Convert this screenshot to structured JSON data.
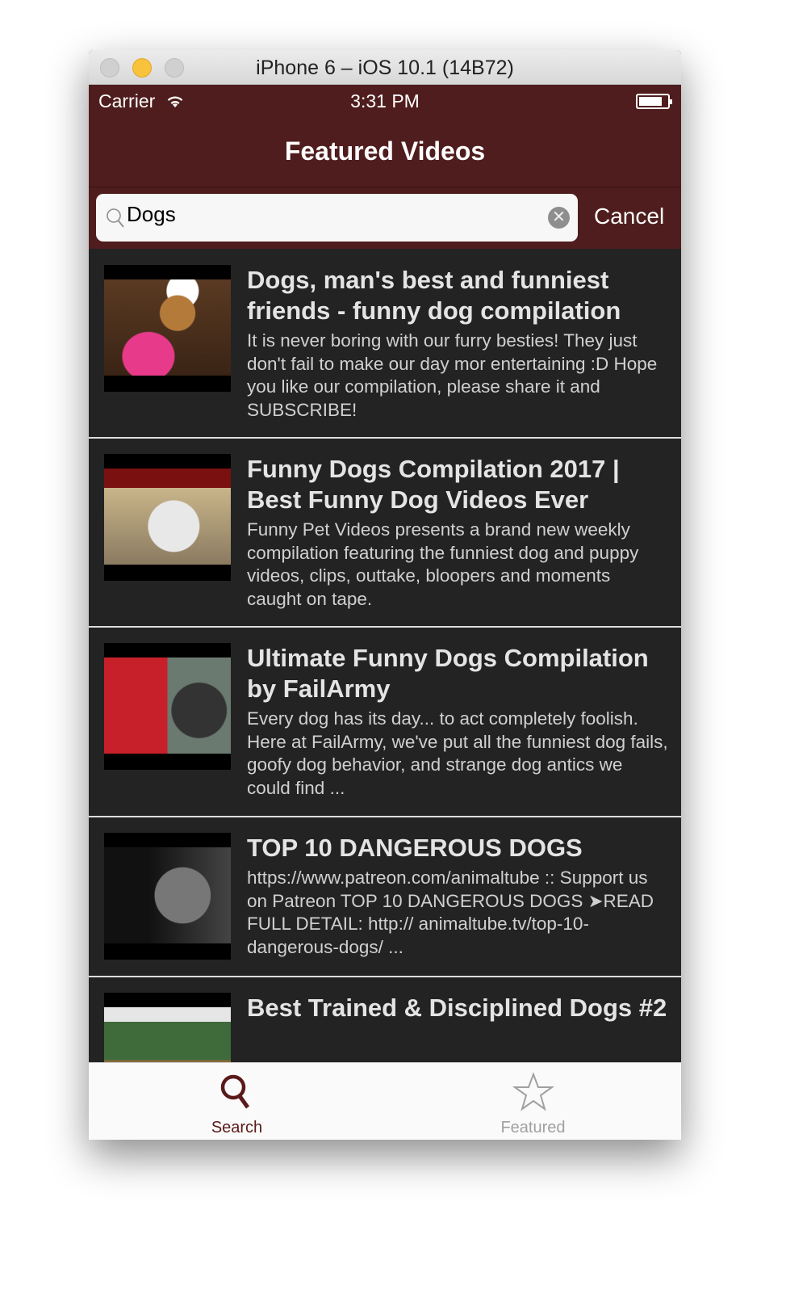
{
  "window": {
    "title": "iPhone 6 – iOS 10.1 (14B72)"
  },
  "status": {
    "carrier": "Carrier",
    "time": "3:31 PM"
  },
  "nav": {
    "title": "Featured Videos"
  },
  "search": {
    "value": "Dogs",
    "cancel": "Cancel"
  },
  "videos": [
    {
      "title": "Dogs, man's best and funniest friends - funny dog compilation",
      "description": "It is never boring with our furry besties! They just don't fail to make our day mor entertaining :D Hope you like our compilation, please share it and SUBSCRIBE!"
    },
    {
      "title": "Funny Dogs Compilation 2017 | Best Funny Dog Videos Ever",
      "description": "Funny Pet Videos presents a brand new weekly compilation featuring the funniest dog and puppy videos, clips, outtake, bloopers and moments caught on tape."
    },
    {
      "title": "Ultimate Funny Dogs Compilation by FailArmy",
      "description": "Every dog has its day... to act completely foolish. Here at FailArmy, we've put all the funniest dog fails, goofy dog behavior, and strange dog antics we could find ..."
    },
    {
      "title": "TOP 10 DANGEROUS DOGS",
      "description": "https://www.patreon.com/animaltube :: Support us on Patreon TOP 10 DANGEROUS DOGS ➤READ FULL DETAIL: http:// animaltube.tv/top-10-dangerous-dogs/ ..."
    },
    {
      "title": "Best Trained & Disciplined Dogs #2",
      "description": ""
    }
  ],
  "tabs": [
    {
      "label": "Search",
      "color": "#5a1a1a"
    },
    {
      "label": "Featured",
      "color": "#a0a0a0"
    }
  ]
}
